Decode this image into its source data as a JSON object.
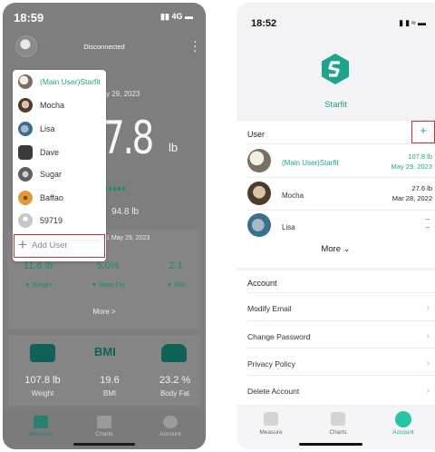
{
  "left_screen": {
    "status": {
      "time": "18:59",
      "network": "4G"
    },
    "header": {
      "connection_status": "Disconnected"
    },
    "measurement": {
      "date": "y 29, 2023",
      "weight": "7.8",
      "unit": "lb",
      "target": "94.8 lb"
    },
    "stats": {
      "date": "1 May 29, 2023",
      "weight_change": "11.6 lb",
      "body_fat_change": "5.0%",
      "bmi_change": "2.1",
      "weight_label": "Weight",
      "body_fat_label": "Body Fat",
      "bmi_label": "BMI",
      "more_label": "More >"
    },
    "tiles": [
      {
        "value": "107.8 lb",
        "label": "Weight"
      },
      {
        "value": "19.6",
        "label": "BMI",
        "icon_text": "BMI"
      },
      {
        "value": "23.2 %",
        "label": "Body Fat"
      }
    ],
    "user_dropdown": {
      "users": [
        {
          "name": "(Main User)Starfit",
          "avatar": "dog-avatar"
        },
        {
          "name": "Mocha",
          "avatar": "dog-avatar"
        },
        {
          "name": "Lisa",
          "avatar": "dog-avatar"
        },
        {
          "name": "Dave",
          "avatar": "phone-avatar"
        },
        {
          "name": "Sugar",
          "avatar": "cat-avatar"
        },
        {
          "name": "Baffao",
          "avatar": "cookie-avatar"
        },
        {
          "name": "59719",
          "avatar": "person-avatar"
        }
      ],
      "add_user_label": "Add User"
    },
    "tabbar": {
      "measure": "Measure",
      "charts": "Charts",
      "account": "Account"
    }
  },
  "right_screen": {
    "status": {
      "time": "18:52"
    },
    "brand": "Starfit",
    "user_section": {
      "title": "User",
      "add_label": "+",
      "users": [
        {
          "name": "(Main User)Starfit",
          "weight": "107.8 lb",
          "date": "May 29, 2023"
        },
        {
          "name": "Mocha",
          "weight": "27.6 lb",
          "date": "Mar 28, 2022"
        },
        {
          "name": "Lisa",
          "weight": "--",
          "date": "--"
        }
      ],
      "more_label": "More"
    },
    "account_section": {
      "title": "Account",
      "items": [
        "Modify Email",
        "Change Password",
        "Privacy Policy",
        "Delete Account"
      ]
    },
    "tabbar": {
      "measure": "Measure",
      "charts": "Charts",
      "account": "Account"
    }
  },
  "colors": {
    "accent": "#1ea38c",
    "highlight_border": "#d92b2b",
    "overlay": "#7e7e7e"
  }
}
